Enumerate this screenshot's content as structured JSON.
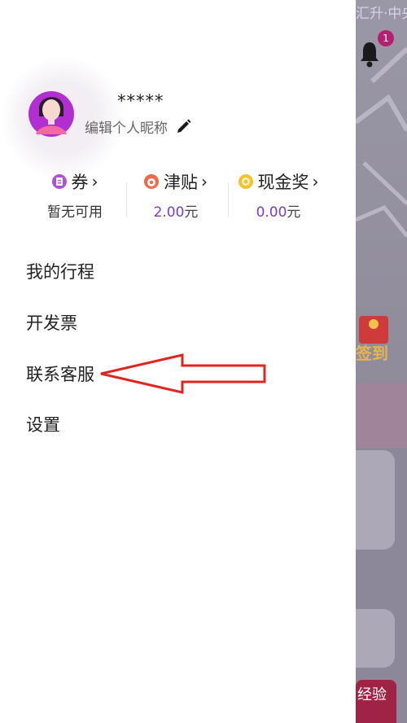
{
  "profile": {
    "nickname": "*****",
    "edit_label": "编辑个人昵称"
  },
  "stats": [
    {
      "label": "券",
      "value": "暂无可用",
      "unit": "",
      "icon": "ticket-icon",
      "color": "#b152d4"
    },
    {
      "label": "津贴",
      "value": "2.00",
      "unit": "元",
      "icon": "allowance-coin-icon",
      "color": "#f06a4a"
    },
    {
      "label": "现金奖",
      "value": "0.00",
      "unit": "元",
      "icon": "cash-coin-icon",
      "color": "#f2c233"
    }
  ],
  "menu": [
    {
      "label": "我的行程"
    },
    {
      "label": "开发票"
    },
    {
      "label": "联系客服"
    },
    {
      "label": "设置"
    }
  ],
  "background": {
    "top_text": "汇升·中央",
    "notification_count": "1",
    "sign_label": "签到",
    "bottom_badge": "经验"
  }
}
